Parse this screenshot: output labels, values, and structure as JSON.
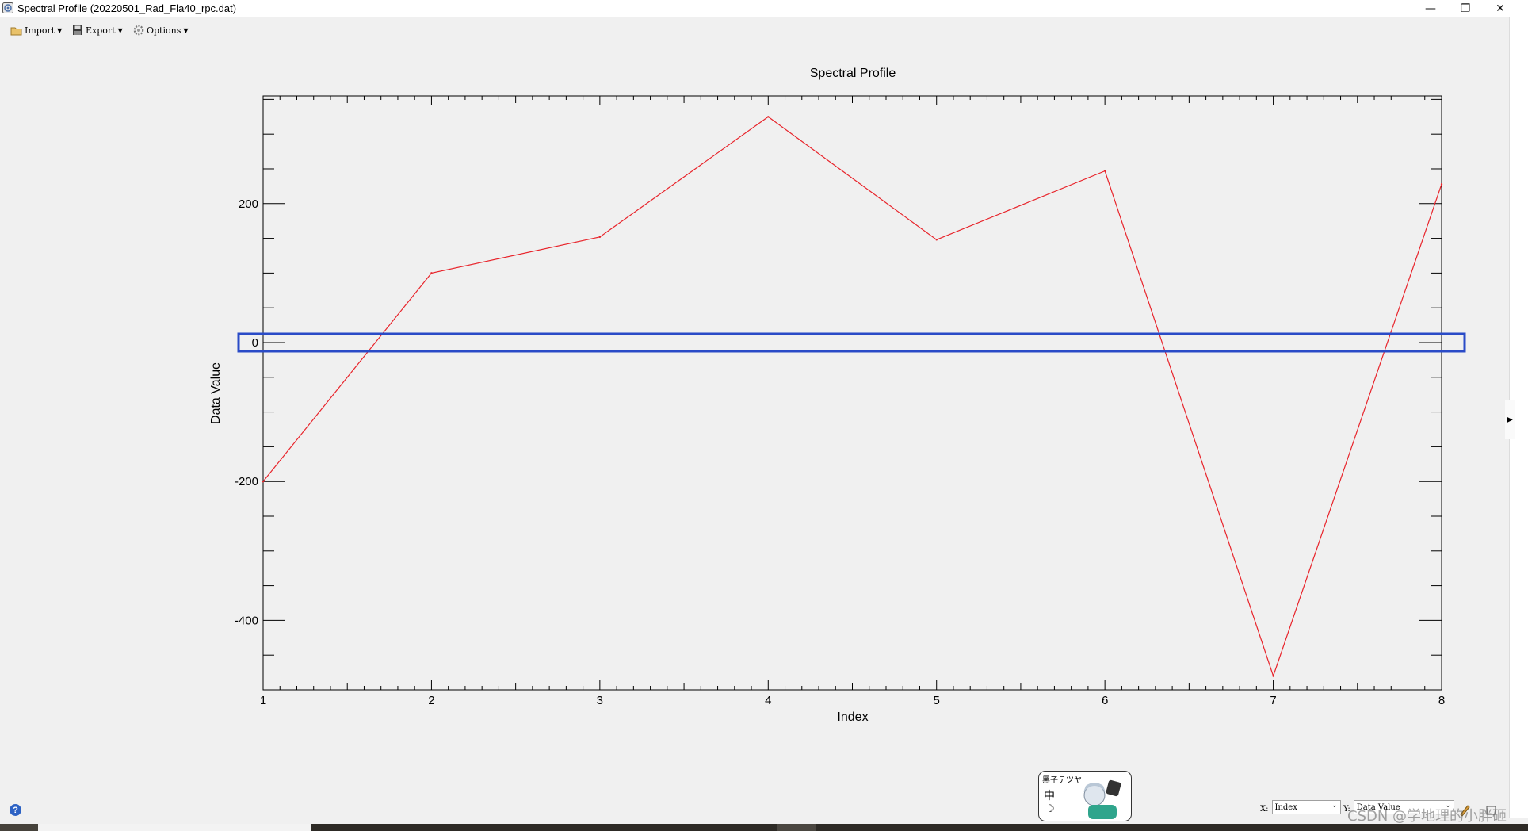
{
  "window": {
    "title": "Spectral Profile (20220501_Rad_Fla40_rpc.dat)",
    "minimize_glyph": "—",
    "restore_glyph": "❐",
    "close_glyph": "✕"
  },
  "toolbar": {
    "import_label": "Import",
    "export_label": "Export",
    "options_label": "Options"
  },
  "chart_data": {
    "type": "line",
    "title": "Spectral Profile",
    "xlabel": "Index",
    "ylabel": "Data Value",
    "x": [
      1,
      2,
      3,
      4,
      5,
      6,
      7,
      8
    ],
    "series": [
      {
        "values": [
          -200,
          100,
          152,
          325,
          148,
          247,
          -480,
          228
        ],
        "color": "#e8242b"
      }
    ],
    "xlim": [
      1,
      8
    ],
    "ylim": [
      -500,
      355
    ],
    "x_ticks": [
      "1",
      "2",
      "3",
      "4",
      "5",
      "6",
      "7",
      "8"
    ],
    "y_ticks": [
      "-400",
      "-200",
      "0",
      "200"
    ],
    "grid": false,
    "highlight": {
      "y": 0,
      "color": "#2a4bc7"
    }
  },
  "help": {
    "glyph": "?"
  },
  "ime": {
    "text": "黑子テツヤ",
    "char": "中",
    "moon": "☽"
  },
  "axis_selectors": {
    "x_label": "X:",
    "x_value": "Index",
    "y_label": "Y:",
    "y_value": "Data Value"
  },
  "watermark": "CSDN @学地理的小胖砸"
}
